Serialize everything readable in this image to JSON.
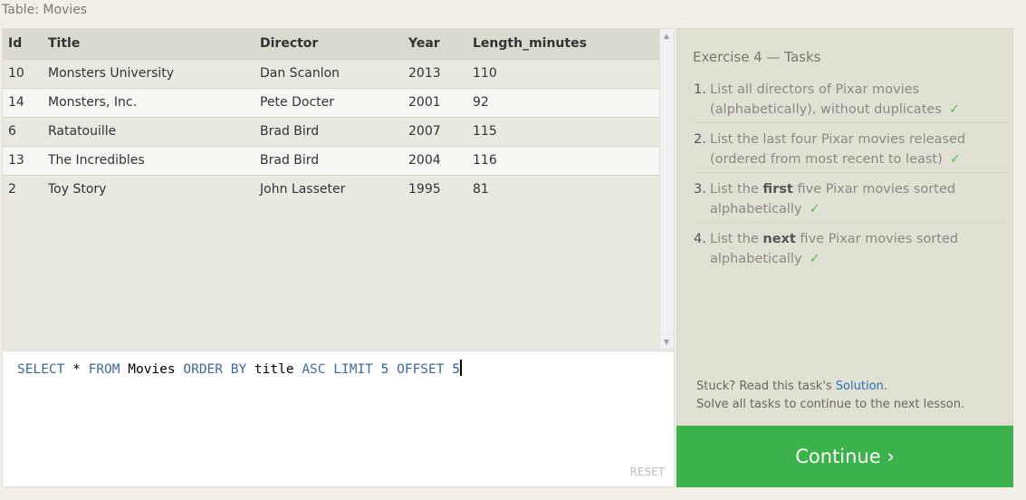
{
  "table": {
    "caption": "Table: Movies",
    "columns": [
      "Id",
      "Title",
      "Director",
      "Year",
      "Length_minutes"
    ],
    "rows": [
      [
        "10",
        "Monsters University",
        "Dan Scanlon",
        "2013",
        "110"
      ],
      [
        "14",
        "Monsters, Inc.",
        "Pete Docter",
        "2001",
        "92"
      ],
      [
        "6",
        "Ratatouille",
        "Brad Bird",
        "2007",
        "115"
      ],
      [
        "13",
        "The Incredibles",
        "Brad Bird",
        "2004",
        "116"
      ],
      [
        "2",
        "Toy Story",
        "John Lasseter",
        "1995",
        "81"
      ]
    ]
  },
  "editor": {
    "query_tokens": [
      {
        "t": "SELECT",
        "k": "kw"
      },
      {
        "t": " * ",
        "k": "id"
      },
      {
        "t": "FROM",
        "k": "kw"
      },
      {
        "t": " Movies ",
        "k": "id"
      },
      {
        "t": "ORDER BY",
        "k": "kw"
      },
      {
        "t": " title ",
        "k": "id"
      },
      {
        "t": "ASC",
        "k": "kw"
      },
      {
        "t": " ",
        "k": "id"
      },
      {
        "t": "LIMIT",
        "k": "kw"
      },
      {
        "t": " ",
        "k": "id"
      },
      {
        "t": "5",
        "k": "num"
      },
      {
        "t": " ",
        "k": "id"
      },
      {
        "t": "OFFSET",
        "k": "kw"
      },
      {
        "t": " ",
        "k": "id"
      },
      {
        "t": "5",
        "k": "num"
      }
    ],
    "reset_label": "RESET"
  },
  "tasks": {
    "title": "Exercise 4 — Tasks",
    "items": [
      {
        "num": "1.",
        "before": "List all directors of Pixar movies (alphabetically), without duplicates",
        "bold": "",
        "after": "",
        "done": true
      },
      {
        "num": "2.",
        "before": "List the last four Pixar movies released (ordered from most recent to least)",
        "bold": "",
        "after": "",
        "done": true
      },
      {
        "num": "3.",
        "before": "List the ",
        "bold": "first",
        "after": " five Pixar movies sorted alphabetically",
        "done": true
      },
      {
        "num": "4.",
        "before": "List the ",
        "bold": "next",
        "after": " five Pixar movies sorted alphabetically",
        "done": true
      }
    ],
    "check_glyph": "✓",
    "stuck_prefix": "Stuck? Read this task's ",
    "solution_link": "Solution",
    "stuck_suffix": ".",
    "solve_all": "Solve all tasks to continue to the next lesson."
  },
  "continue_label": "Continue ›",
  "colors": {
    "accent_green": "#3bb34a",
    "keyword_blue": "#3e6a9e",
    "link_blue": "#2d6db5",
    "check_green": "#67b562"
  }
}
